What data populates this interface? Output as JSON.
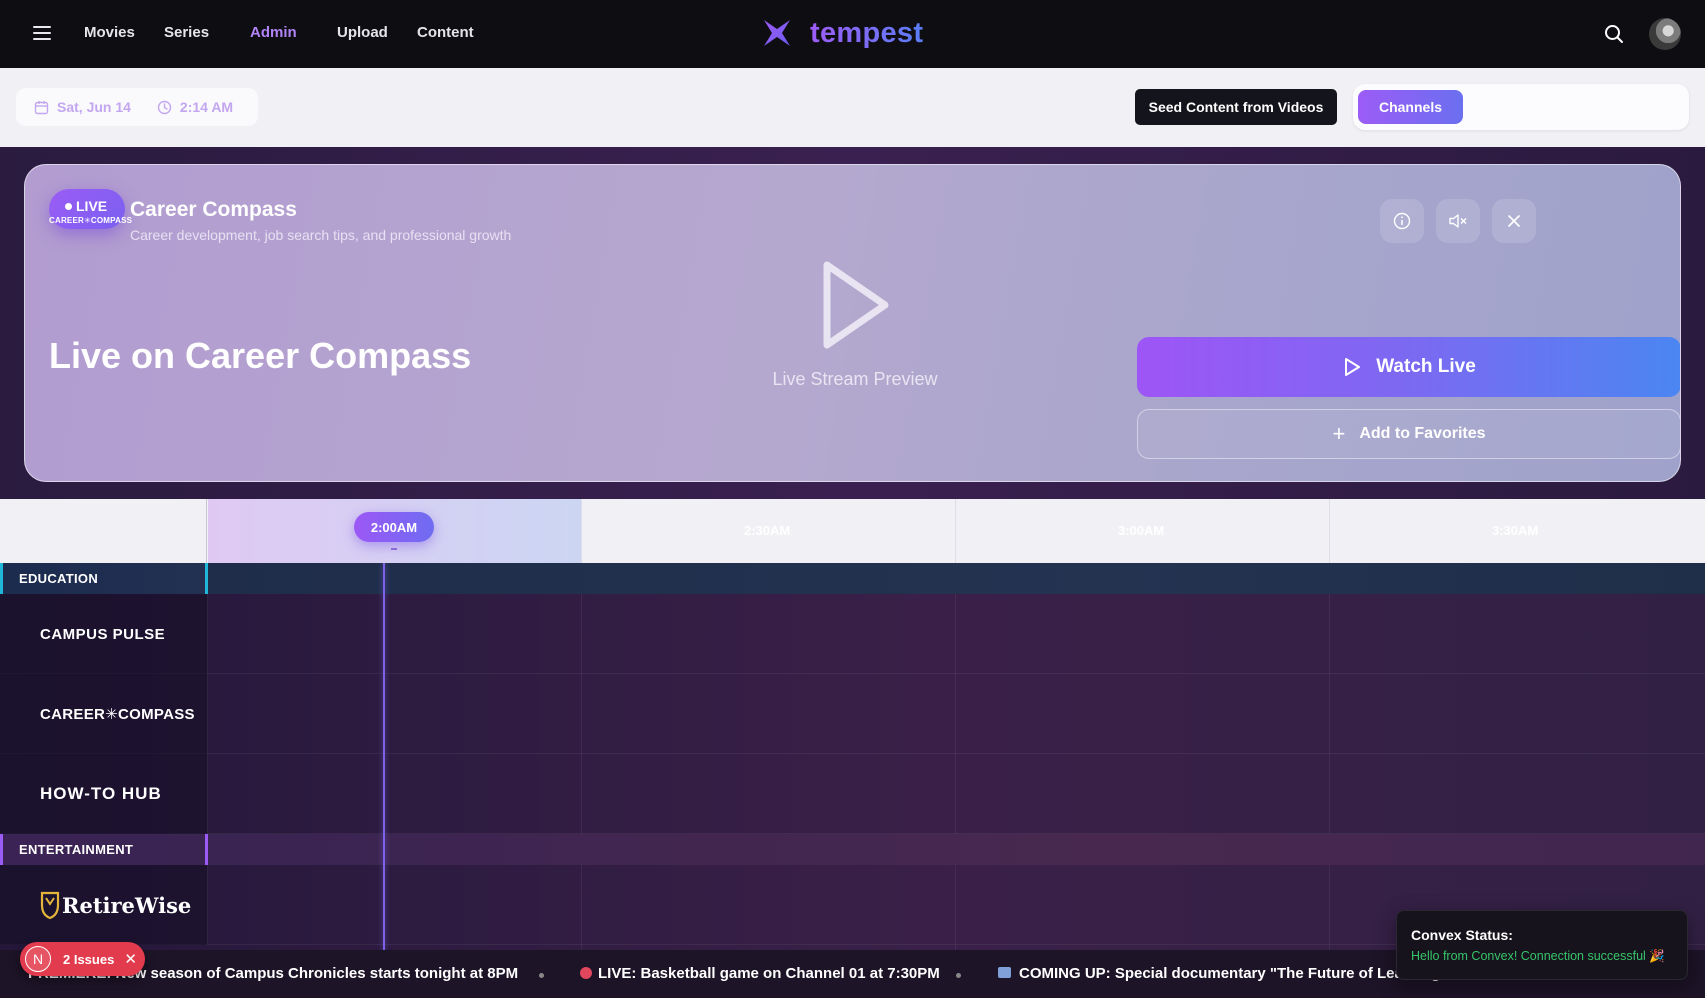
{
  "nav": {
    "links": [
      "Movies",
      "Series",
      "Admin",
      "Upload",
      "Content"
    ],
    "brand": "tempest"
  },
  "toolbar": {
    "date": "Sat, Jun 14",
    "time": "2:14 AM",
    "seed_label": "Seed Content from Videos",
    "channels_label": "Channels"
  },
  "hero": {
    "live_label": "LIVE",
    "badge_logo": "CAREER✳COMPASS",
    "channel_name": "Career Compass",
    "channel_desc": "Career development, job search tips, and professional growth",
    "title": "Live on Career Compass",
    "preview_label": "Live Stream Preview",
    "watch_label": "Watch Live",
    "fav_label": "Add to Favorites"
  },
  "timeline": {
    "now_label": "2:00AM",
    "slots": [
      "2:30AM",
      "3:00AM",
      "3:30AM"
    ]
  },
  "guide": {
    "categories": [
      {
        "name": "EDUCATION",
        "color": "#22b6d8",
        "channels": [
          "CAMPUS PULSE",
          "CAREER✳COMPASS",
          "HOW-TO HUB"
        ]
      },
      {
        "name": "ENTERTAINMENT",
        "color": "#9b5cf5",
        "channels": [
          "RetireWise"
        ]
      }
    ]
  },
  "ticker": {
    "items": [
      "PREMIERE: New season of Campus Chronicles starts tonight at 8PM",
      "LIVE: Basketball game on Channel 01 at 7:30PM",
      "COMING UP: Special documentary \"The Future of Learning\""
    ]
  },
  "issues": {
    "initial": "N",
    "label": "2 Issues"
  },
  "toast": {
    "title": "Convex Status:",
    "message": "Hello from Convex! Connection successful 🎉"
  },
  "colors": {
    "accent_purple": "#9c58f5",
    "accent_blue": "#4b86f2",
    "education": "#22b6d8",
    "entertainment": "#9b5cf5",
    "issues_red": "#e23b4d",
    "toast_green": "#36c46a"
  }
}
